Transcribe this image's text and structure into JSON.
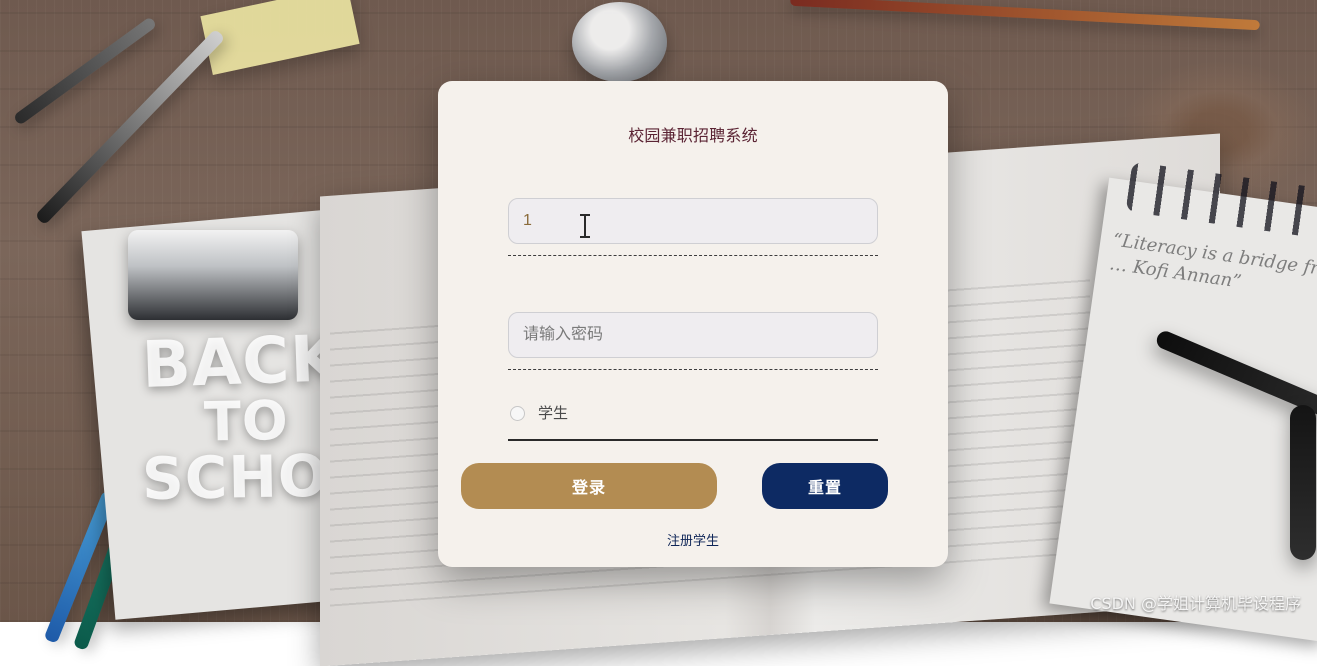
{
  "login": {
    "title": "校园兼职招聘系统",
    "username_value": "1",
    "password_placeholder": "请输入密码",
    "role_label": "学生",
    "login_button": "登录",
    "reset_button": "重置",
    "register_link": "注册学生"
  },
  "background": {
    "handwriting": "“Literacy is a bridge from … Kofi Annan”",
    "clipboard_text": {
      "line1": "BACK",
      "line2": "TO",
      "line3": "SCHOOL"
    }
  },
  "watermark": {
    "text": "CSDN @学姐计算机毕设程序"
  },
  "colors": {
    "title": "#5b2434",
    "login_button": "#b38c52",
    "reset_button": "#0d2a63",
    "card_bg": "#f5f1ec"
  },
  "icons": {
    "text_cursor": "text-cursor-icon",
    "radio": "radio-unchecked-icon"
  }
}
